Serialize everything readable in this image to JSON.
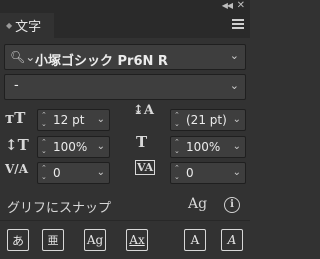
{
  "panel": {
    "tab_label": "文字",
    "font_family": "小塚ゴシック Pr6N R",
    "font_style": "-"
  },
  "character": {
    "font_size": "12 pt",
    "leading": "(21 pt)",
    "vertical_scale": "100%",
    "horizontal_scale": "100%",
    "kerning": "0",
    "tracking": "0"
  },
  "snap": {
    "label": "グリフにスナップ"
  },
  "snap_buttons": {
    "b1": "あ",
    "b2": "亜",
    "b3": "Ag",
    "b4": "Ax",
    "b5": "A",
    "b6": "A"
  },
  "icons": [
    "collapse-icon",
    "close-icon",
    "panel-menu-icon",
    "search-icon",
    "chevron-down-icon",
    "font-size-icon",
    "leading-icon",
    "vertical-scale-icon",
    "horizontal-scale-icon",
    "kerning-icon",
    "tracking-icon",
    "glyph-icon",
    "info-icon"
  ]
}
